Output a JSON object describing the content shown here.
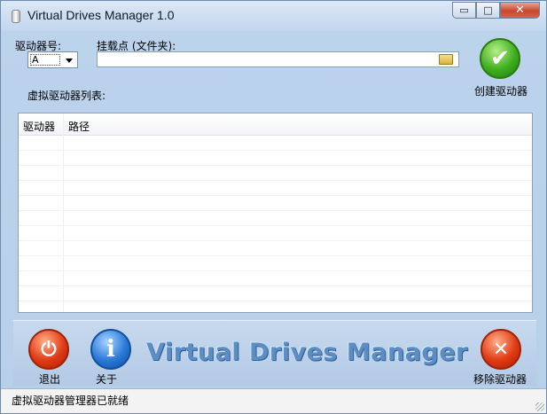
{
  "window": {
    "title": "Virtual Drives Manager 1.0",
    "minimize_glyph": "▭",
    "maximize_glyph": "□",
    "close_glyph": "✕"
  },
  "drive": {
    "label": "驱动器号:",
    "selected": "A"
  },
  "mount": {
    "label": "挂载点 (文件夹):",
    "value": ""
  },
  "create_button": {
    "label": "创建驱动器",
    "icon": "checkmark-icon",
    "glyph": "✔"
  },
  "list": {
    "title": "虚拟驱动器列表:",
    "columns": [
      "驱动器",
      "路径"
    ],
    "rows": []
  },
  "bottom": {
    "exit_label": "退出",
    "exit_glyph": "⏻",
    "about_label": "关于",
    "about_glyph": "i",
    "remove_label": "移除驱动器",
    "remove_glyph": "✕",
    "brand": "Virtual Drives Manager"
  },
  "status": {
    "text": "虚拟驱动器管理器已就绪"
  },
  "colors": {
    "accent": "#5c8ec4",
    "create": "#3fae1e",
    "remove": "#e03a14",
    "about": "#2a79d8"
  }
}
